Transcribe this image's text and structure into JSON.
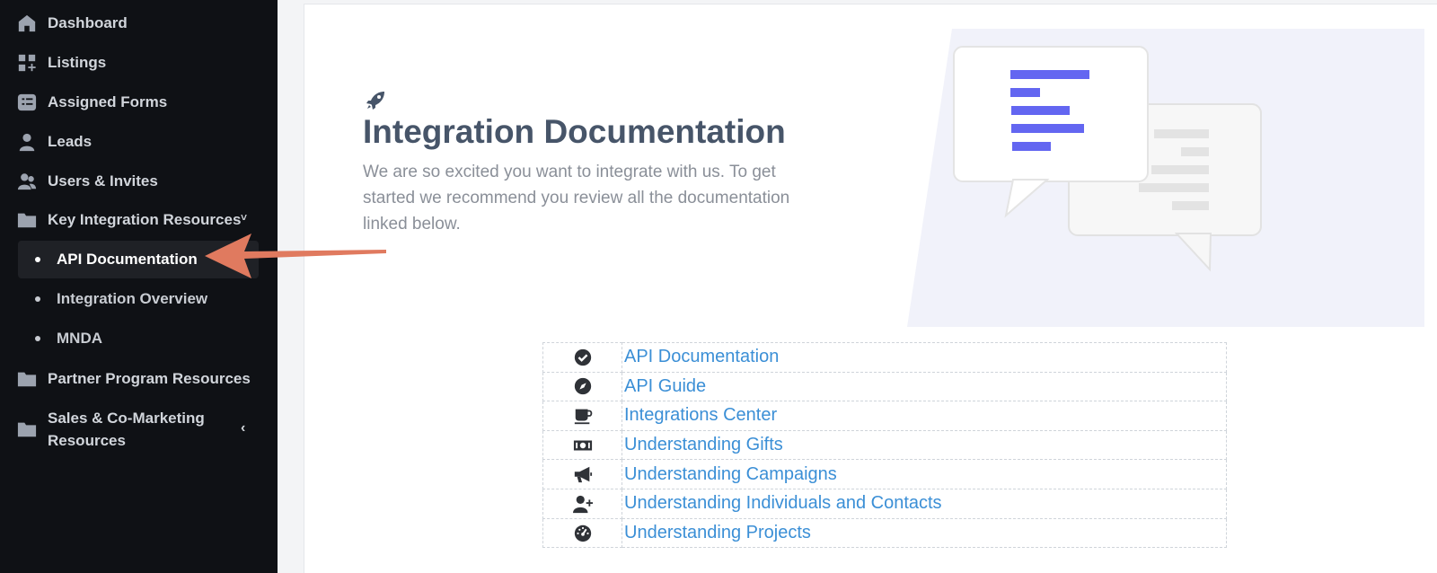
{
  "sidebar": {
    "items": [
      {
        "label": "Dashboard",
        "icon": "home-icon"
      },
      {
        "label": "Listings",
        "icon": "grid-plus-icon"
      },
      {
        "label": "Assigned Forms",
        "icon": "checklist-icon"
      },
      {
        "label": "Leads",
        "icon": "user-icon"
      },
      {
        "label": "Users & Invites",
        "icon": "users-icon"
      },
      {
        "label": "Key Integration Resources",
        "icon": "folder-icon",
        "chevron": "˅"
      }
    ],
    "subitems": [
      {
        "label": "API Documentation",
        "active": true
      },
      {
        "label": "Integration Overview"
      },
      {
        "label": "MNDA"
      }
    ],
    "more": [
      {
        "label": "Partner Program Resources",
        "icon": "folder-icon"
      },
      {
        "label": "Sales & Co-Marketing Resources",
        "icon": "folder-icon",
        "chevron": "‹"
      }
    ]
  },
  "main": {
    "title": "Integration Documentation",
    "subtitle": "We are so excited you want to integrate with us. To get started we recommend you review all the documentation linked below.",
    "links": [
      {
        "label": "API Documentation",
        "icon": "check-circle-icon"
      },
      {
        "label": "API Guide",
        "icon": "compass-icon"
      },
      {
        "label": "Integrations Center",
        "icon": "coffee-icon"
      },
      {
        "label": "Understanding Gifts",
        "icon": "money-bill-icon"
      },
      {
        "label": "Understanding Campaigns",
        "icon": "bullhorn-icon"
      },
      {
        "label": "Understanding Individuals and Contacts",
        "icon": "user-plus-icon"
      },
      {
        "label": "Understanding Projects",
        "icon": "gauge-icon"
      }
    ]
  },
  "colors": {
    "sidebar_bg": "#0f1115",
    "link": "#3b8fd6",
    "accent_bars": "#6366f1",
    "arrow": "#e07a5f"
  }
}
